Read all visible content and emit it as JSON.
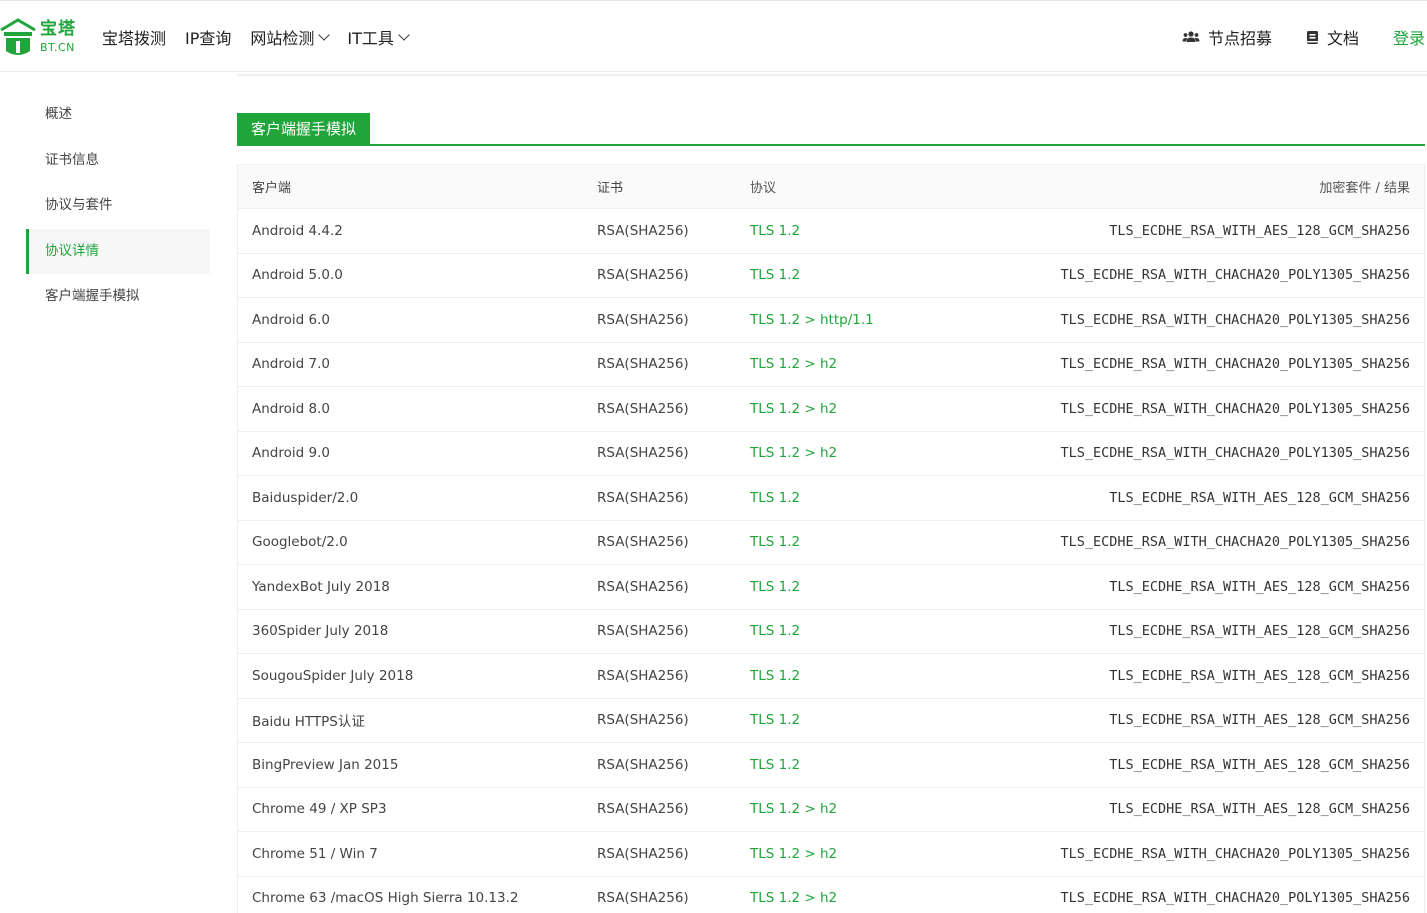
{
  "header": {
    "logo_cn": "宝塔",
    "logo_en": "BT.CN",
    "nav": [
      {
        "label": "宝塔拨测",
        "dropdown": false
      },
      {
        "label": "IP查询",
        "dropdown": false
      },
      {
        "label": "网站检测",
        "dropdown": true
      },
      {
        "label": "IT工具",
        "dropdown": true
      }
    ],
    "node_recruit": "节点招募",
    "docs": "文档",
    "login": "登录"
  },
  "sidebar": {
    "items": [
      {
        "label": "概述",
        "active": false
      },
      {
        "label": "证书信息",
        "active": false
      },
      {
        "label": "协议与套件",
        "active": false
      },
      {
        "label": "协议详情",
        "active": true
      },
      {
        "label": "客户端握手模拟",
        "active": false
      }
    ]
  },
  "section": {
    "title": "客户端握手模拟"
  },
  "table": {
    "headers": [
      "客户端",
      "证书",
      "协议",
      "加密套件 / 结果"
    ],
    "rows": [
      [
        "Android 4.4.2",
        "RSA(SHA256)",
        "TLS 1.2",
        "TLS_ECDHE_RSA_WITH_AES_128_GCM_SHA256"
      ],
      [
        "Android 5.0.0",
        "RSA(SHA256)",
        "TLS 1.2",
        "TLS_ECDHE_RSA_WITH_CHACHA20_POLY1305_SHA256"
      ],
      [
        "Android 6.0",
        "RSA(SHA256)",
        "TLS 1.2 > http/1.1",
        "TLS_ECDHE_RSA_WITH_CHACHA20_POLY1305_SHA256"
      ],
      [
        "Android 7.0",
        "RSA(SHA256)",
        "TLS 1.2 > h2",
        "TLS_ECDHE_RSA_WITH_CHACHA20_POLY1305_SHA256"
      ],
      [
        "Android 8.0",
        "RSA(SHA256)",
        "TLS 1.2 > h2",
        "TLS_ECDHE_RSA_WITH_CHACHA20_POLY1305_SHA256"
      ],
      [
        "Android 9.0",
        "RSA(SHA256)",
        "TLS 1.2 > h2",
        "TLS_ECDHE_RSA_WITH_CHACHA20_POLY1305_SHA256"
      ],
      [
        "Baiduspider/2.0",
        "RSA(SHA256)",
        "TLS 1.2",
        "TLS_ECDHE_RSA_WITH_AES_128_GCM_SHA256"
      ],
      [
        "Googlebot/2.0",
        "RSA(SHA256)",
        "TLS 1.2",
        "TLS_ECDHE_RSA_WITH_CHACHA20_POLY1305_SHA256"
      ],
      [
        "YandexBot July 2018",
        "RSA(SHA256)",
        "TLS 1.2",
        "TLS_ECDHE_RSA_WITH_AES_128_GCM_SHA256"
      ],
      [
        "360Spider July 2018",
        "RSA(SHA256)",
        "TLS 1.2",
        "TLS_ECDHE_RSA_WITH_AES_128_GCM_SHA256"
      ],
      [
        "SougouSpider July 2018",
        "RSA(SHA256)",
        "TLS 1.2",
        "TLS_ECDHE_RSA_WITH_AES_128_GCM_SHA256"
      ],
      [
        "Baidu HTTPS认证",
        "RSA(SHA256)",
        "TLS 1.2",
        "TLS_ECDHE_RSA_WITH_AES_128_GCM_SHA256"
      ],
      [
        "BingPreview Jan 2015",
        "RSA(SHA256)",
        "TLS 1.2",
        "TLS_ECDHE_RSA_WITH_AES_128_GCM_SHA256"
      ],
      [
        "Chrome 49 / XP SP3",
        "RSA(SHA256)",
        "TLS 1.2 > h2",
        "TLS_ECDHE_RSA_WITH_AES_128_GCM_SHA256"
      ],
      [
        "Chrome 51 / Win 7",
        "RSA(SHA256)",
        "TLS 1.2 > h2",
        "TLS_ECDHE_RSA_WITH_CHACHA20_POLY1305_SHA256"
      ],
      [
        "Chrome 63 /macOS High Sierra 10.13.2",
        "RSA(SHA256)",
        "TLS 1.2 > h2",
        "TLS_ECDHE_RSA_WITH_CHACHA20_POLY1305_SHA256"
      ]
    ]
  },
  "colors": {
    "brand": "#20a53a"
  }
}
